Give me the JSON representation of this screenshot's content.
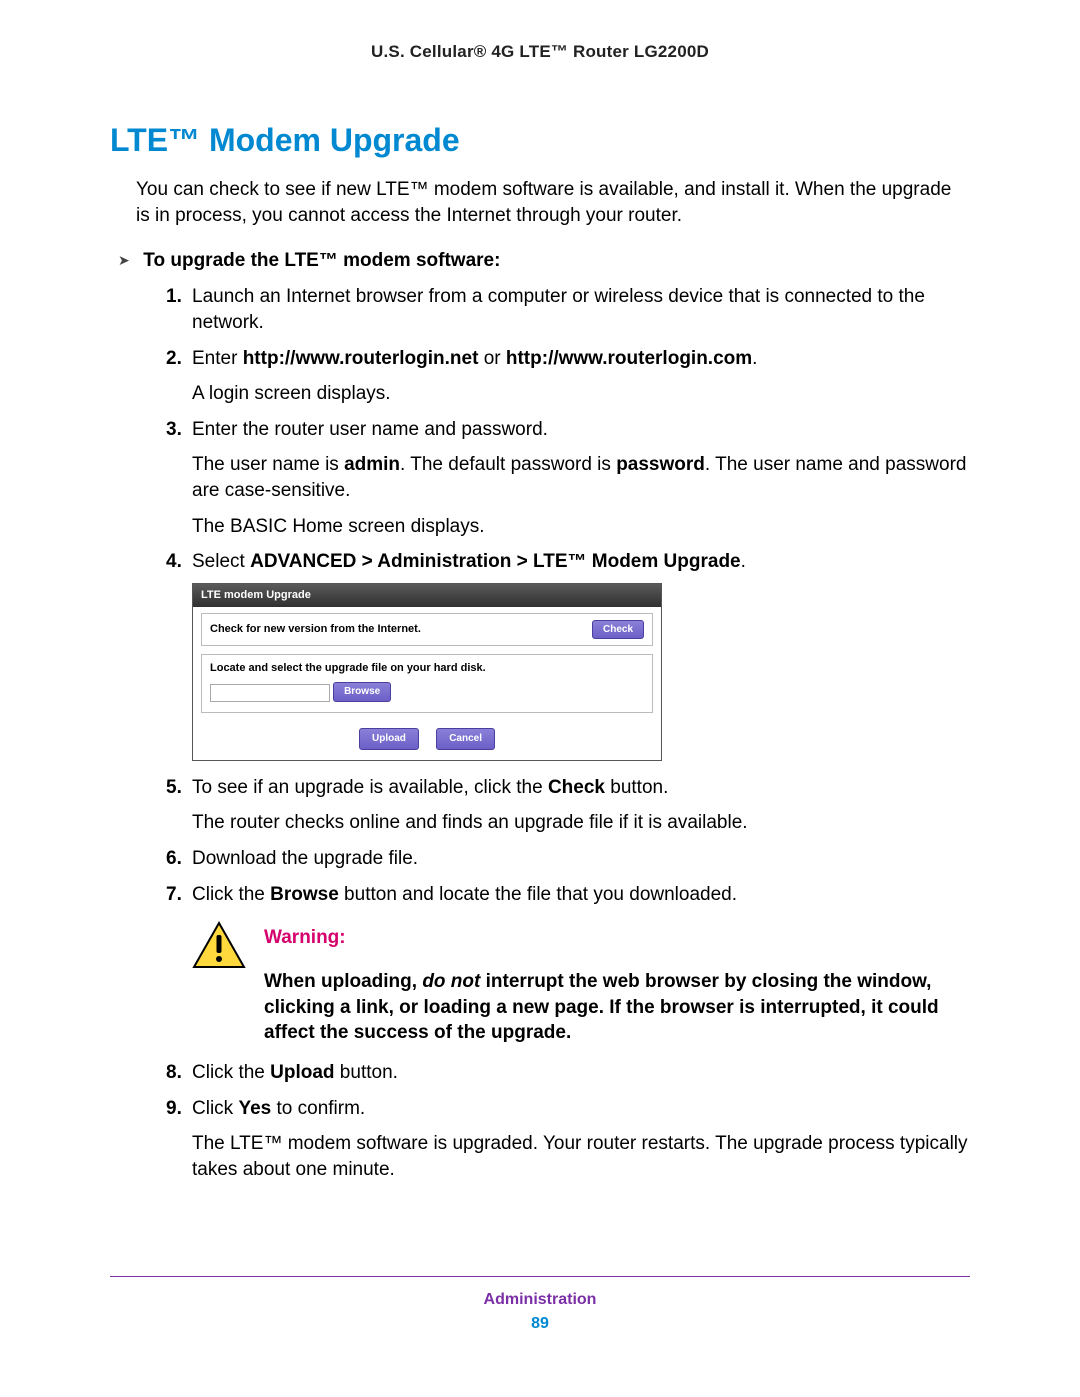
{
  "header": {
    "title": "U.S. Cellular® 4G LTE™ Router LG2200D"
  },
  "section": {
    "title": "LTE™ Modem Upgrade"
  },
  "intro": "You can check to see if new LTE™ modem software is available, and install it. When the upgrade is in process, you cannot access the Internet through your router.",
  "task": {
    "arrow": "➤",
    "label": "To upgrade the LTE™ modem software:"
  },
  "steps": {
    "s1": {
      "num": "1.",
      "text": "Launch an Internet browser from a computer or wireless device that is connected to the network."
    },
    "s2": {
      "num": "2.",
      "pre": "Enter ",
      "b1": "http://www.routerlogin.net",
      "mid": " or ",
      "b2": "http://www.routerlogin.com",
      "post": ".",
      "sub": "A login screen displays."
    },
    "s3": {
      "num": "3.",
      "text": "Enter the router user name and password.",
      "sub1a": "The user name is ",
      "sub1b": "admin",
      "sub1c": ". The default password is ",
      "sub1d": "password",
      "sub1e": ". The user name and password are case-sensitive.",
      "sub2": "The BASIC Home screen displays."
    },
    "s4": {
      "num": "4.",
      "pre": "Select ",
      "b": "ADVANCED > Administration > LTE™ Modem Upgrade",
      "post": "."
    },
    "s5": {
      "num": "5.",
      "pre": "To see if an upgrade is available, click the ",
      "b": "Check",
      "post": " button.",
      "sub": "The router checks online and finds an upgrade file if it is available."
    },
    "s6": {
      "num": "6.",
      "text": "Download the upgrade file."
    },
    "s7": {
      "num": "7.",
      "pre": "Click the ",
      "b": "Browse",
      "post": " button and locate the file that you downloaded."
    },
    "s8": {
      "num": "8.",
      "pre": "Click the ",
      "b": "Upload",
      "post": " button."
    },
    "s9": {
      "num": "9.",
      "pre": "Click ",
      "b": "Yes",
      "post": " to confirm.",
      "sub": "The LTE™ modem software is upgraded. Your router restarts. The upgrade process typically takes about one minute."
    }
  },
  "uishot": {
    "title": "LTE modem Upgrade",
    "check_label": "Check for new version from the Internet.",
    "check_btn": "Check",
    "locate_label": "Locate and select the upgrade file on your hard disk.",
    "browse_btn": "Browse",
    "upload_btn": "Upload",
    "cancel_btn": "Cancel"
  },
  "warning": {
    "title": "Warning:",
    "pre": "When uploading, ",
    "em": "do not",
    "post": " interrupt the web browser by closing the window, clicking a link, or loading a new page. If the browser is interrupted, it could affect the success of the upgrade."
  },
  "footer": {
    "section": "Administration",
    "page": "89"
  }
}
